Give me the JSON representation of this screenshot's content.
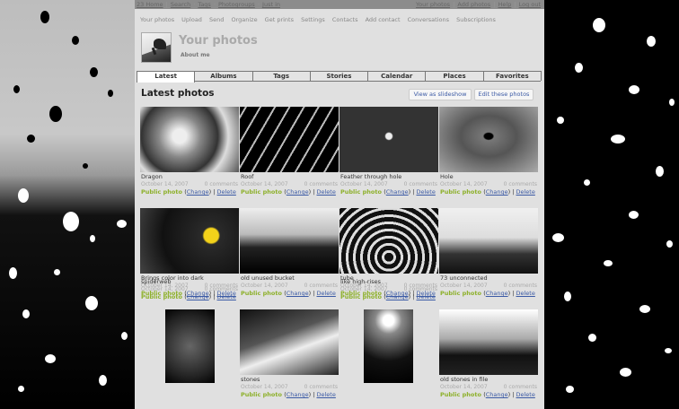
{
  "topnav": {
    "left": [
      "23 Home",
      "Search",
      "Tags",
      "Photogroups",
      "Just in"
    ],
    "right": [
      "Your photos",
      "Add photos",
      "Help",
      "Log out"
    ]
  },
  "mainmenu": [
    "Your photos",
    "Upload",
    "Send",
    "Organize",
    "Get prints",
    "Settings",
    "Contacts",
    "Add contact",
    "Conversations",
    "Subscriptions"
  ],
  "header": {
    "title": "Your photos",
    "about": "About me"
  },
  "tabs": [
    "Latest",
    "Albums",
    "Tags",
    "Stories",
    "Calendar",
    "Places",
    "Favorites"
  ],
  "active_tab": "Latest",
  "section": {
    "title": "Latest photos",
    "slideshow_button": "View as slideshow",
    "edit_button": "Edit these photos"
  },
  "photo_labels": {
    "privacy": "Public photo",
    "change": "Change",
    "delete": "Delete"
  },
  "photos": [
    {
      "caption": "Dragon",
      "date": "October 14, 2007",
      "comments": "0 comments",
      "icon": "dragon-sculpture"
    },
    {
      "caption": "Roof",
      "date": "October 14, 2007",
      "comments": "0 comments",
      "icon": "roof-structure"
    },
    {
      "caption": "Feather through hole",
      "date": "October 14, 2007",
      "comments": "0 comments",
      "icon": "feather-hole"
    },
    {
      "caption": "Hole",
      "date": "October 14, 2007",
      "comments": "0 comments",
      "icon": "hole-wood"
    },
    {
      "caption": "Brings color into dark",
      "date": "October 14, 2007",
      "comments": "0 comments",
      "icon": "yellow-flower"
    },
    {
      "caption": "old unused bucket",
      "date": "October 14, 2007",
      "comments": "0 comments",
      "icon": "bucket-machine"
    },
    {
      "caption": "tube",
      "date": "October 14, 2007",
      "comments": "0 comments",
      "icon": "tube-tunnel"
    },
    {
      "caption": "73 unconnected",
      "date": "October 14, 2007",
      "comments": "0 comments",
      "icon": "lamp-post"
    },
    {
      "caption": "spiderweb",
      "date": "October 14, 2007",
      "comments": "0 comments",
      "icon": "spiderweb"
    },
    {
      "caption": "stones",
      "date": "October 14, 2007",
      "comments": "0 comments",
      "icon": "stones-stairs"
    },
    {
      "caption": "like high-rises",
      "date": "October 14, 2007",
      "comments": "0 comments",
      "icon": "high-rises"
    },
    {
      "caption": "old stones in file",
      "date": "October 14, 2007",
      "comments": "0 comments",
      "icon": "stone-slabs"
    }
  ],
  "colors": {
    "accent": "#3b5aa5",
    "public": "#8db02a",
    "flower": "#f3d21a"
  }
}
